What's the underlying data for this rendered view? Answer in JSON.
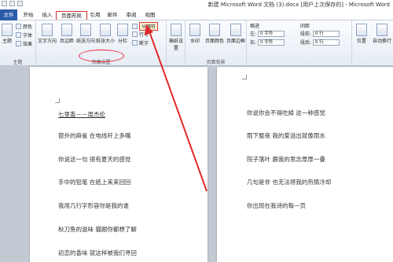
{
  "window": {
    "title": "新建 Microsoft Word 文档 (3).docx [用户上次保存的] - Microsoft Word"
  },
  "tabs": [
    "文件",
    "开始",
    "插入",
    "页面布局",
    "引用",
    "邮件",
    "审阅",
    "视图"
  ],
  "ribbon": {
    "theme_group": {
      "label": "主题",
      "btn": "主题",
      "colors": "颜色",
      "fonts": "字体",
      "effects": "效果"
    },
    "page_setup": {
      "label": "页面设置",
      "buttons": [
        "文字方向",
        "页边距",
        "纸张方向",
        "纸张大小",
        "分栏"
      ],
      "breaks": "分隔符",
      "line_numbers": "行号",
      "hyphenation": "断字"
    },
    "manuscript": {
      "label": "稿纸设置"
    },
    "page_background": {
      "label": "页面背景",
      "buttons": [
        "水印",
        "页面颜色",
        "页面边框"
      ]
    },
    "paragraph": {
      "indent": "缩进",
      "spacing": "间距",
      "left_label": "左:",
      "right_label": "右:",
      "before_label": "段前:",
      "after_label": "段后:",
      "left_value": "0 字符",
      "right_value": "0 字符",
      "before_value": "0 行",
      "after_value": "0 行"
    },
    "arrange": {
      "position": "位置",
      "wrap": "自动换行"
    }
  },
  "doc": {
    "left_lines": [
      "七里香－－周杰伦",
      "窗外的麻雀 在电线杆上多嘴",
      "你说这一句 很有夏天的感觉",
      "手中的铅笔 在纸上来来回回",
      "我用几行字形容你是我的谁",
      "秋刀鱼的滋味 猫跟你都想了解",
      "初恋的香味 就这样被我们寻回"
    ],
    "right_lines": [
      "你说你会不得吃掉 这一种感觉",
      "雨下整夜 我的爱溢出就像雨水",
      "院子落叶 跟我的思念厚厚一叠",
      "几句是非 也无法将我的热情冷却",
      "你出现在我诗的每一页"
    ]
  },
  "colors": {
    "annotation": "#e02a2a",
    "file_tab": "#2a5ca8"
  }
}
